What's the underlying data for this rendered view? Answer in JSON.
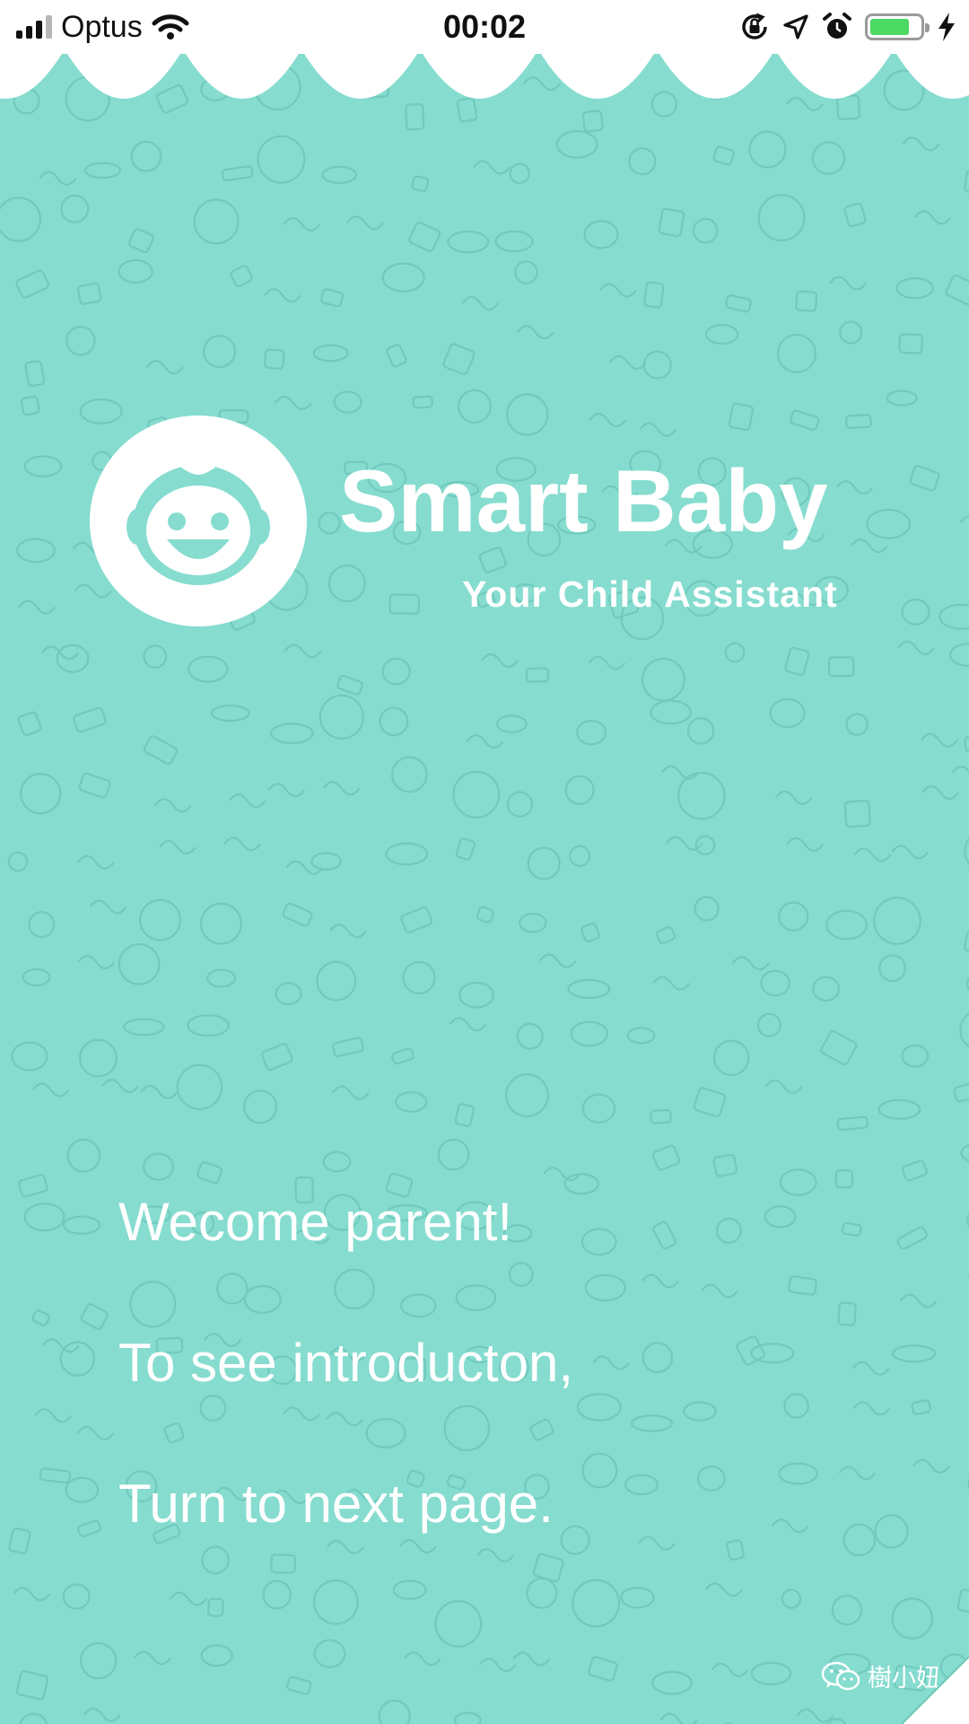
{
  "status_bar": {
    "carrier": "Optus",
    "time": "00:02",
    "battery_level": 0.8,
    "battery_color": "#4cd964"
  },
  "theme": {
    "background": "#86dccf",
    "pattern_stroke": "#5fbcb0",
    "text": "#ffffff"
  },
  "header": {
    "logo_icon": "baby-face-icon",
    "title": "Smart Baby",
    "subtitle": "Your Child Assistant"
  },
  "messages": [
    "Wecome parent!",
    "To see introducton,",
    "Turn to next page."
  ],
  "watermark": {
    "icon": "wechat-icon",
    "text": "樹小妞"
  }
}
